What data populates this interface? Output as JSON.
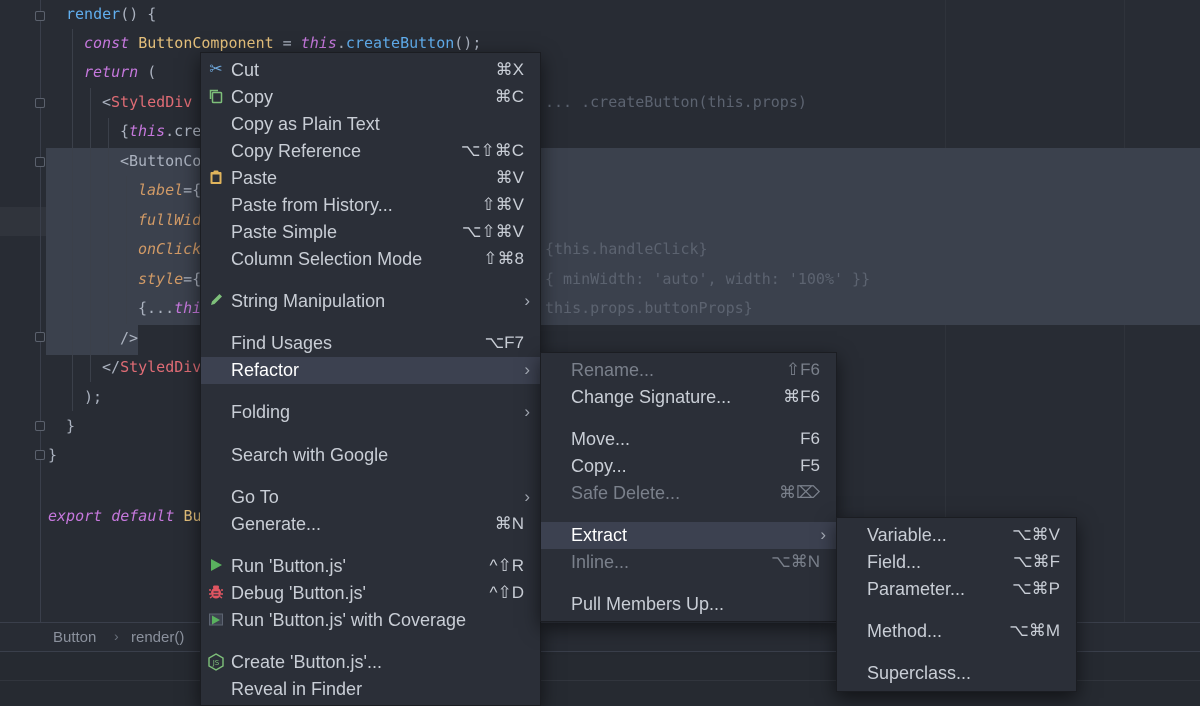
{
  "code": {
    "l1": {
      "name": "render",
      "rest": "() {"
    },
    "l2": {
      "kw": "const",
      "id": "ButtonComponent",
      "eq": " = ",
      "this": "this",
      "dot": ".",
      "fn": "createButton",
      "end": "();"
    },
    "l3": {
      "kw": "return",
      "rest": " ("
    },
    "l4": {
      "open": "<",
      "tag": "StyledDiv",
      "ghost": "... .createButton(this.props)"
    },
    "l5": {
      "brace": "{",
      "this": "this",
      "rest": ".crea"
    },
    "l6": {
      "open": "<ButtonCo"
    },
    "l7": {
      "attr": "label",
      "rest": "={"
    },
    "l8": {
      "attr": "fullWid"
    },
    "l9": {
      "attr": "onClick",
      "ghost": "{this.handleClick}"
    },
    "l10": {
      "attr": "style",
      "rest": "={",
      "ghost": "{ minWidth: 'auto', width: '100%' }}"
    },
    "l11": {
      "rest": "{...",
      "this": "thi",
      "ghost": "this.props.buttonProps}"
    },
    "l12": {
      "rest": "/>"
    },
    "l13": {
      "open": "</",
      "tag": "StyledDiv"
    },
    "l14": {
      "rest": ");"
    },
    "l15": {
      "rest": "}"
    },
    "l16": {
      "rest": "}"
    },
    "l18": {
      "kw1": "export",
      "kw2": "default",
      "id": "Bu"
    }
  },
  "breadcrumb": {
    "item1": "Button",
    "sep": "›",
    "item2": "render()"
  },
  "context_menu": {
    "cut": {
      "label": "Cut",
      "shortcut": "⌘X"
    },
    "copy": {
      "label": "Copy",
      "shortcut": "⌘C"
    },
    "copy_plain": {
      "label": "Copy as Plain Text"
    },
    "copy_ref": {
      "label": "Copy Reference",
      "shortcut": "⌥⇧⌘C"
    },
    "paste": {
      "label": "Paste",
      "shortcut": "⌘V"
    },
    "paste_history": {
      "label": "Paste from History...",
      "shortcut": "⇧⌘V"
    },
    "paste_simple": {
      "label": "Paste Simple",
      "shortcut": "⌥⇧⌘V"
    },
    "column_mode": {
      "label": "Column Selection Mode",
      "shortcut": "⇧⌘8"
    },
    "string_manip": {
      "label": "String Manipulation"
    },
    "find_usages": {
      "label": "Find Usages",
      "shortcut": "⌥F7"
    },
    "refactor": {
      "label": "Refactor"
    },
    "folding": {
      "label": "Folding"
    },
    "search_google": {
      "label": "Search with Google"
    },
    "go_to": {
      "label": "Go To"
    },
    "generate": {
      "label": "Generate...",
      "shortcut": "⌘N"
    },
    "run": {
      "label": "Run 'Button.js'",
      "shortcut": "^⇧R"
    },
    "debug": {
      "label": "Debug 'Button.js'",
      "shortcut": "^⇧D"
    },
    "run_coverage": {
      "label": "Run 'Button.js' with Coverage"
    },
    "create": {
      "label": "Create 'Button.js'..."
    },
    "reveal": {
      "label": "Reveal in Finder"
    },
    "arrow": "›"
  },
  "refactor_menu": {
    "rename": {
      "label": "Rename...",
      "shortcut": "⇧F6"
    },
    "change_sig": {
      "label": "Change Signature...",
      "shortcut": "⌘F6"
    },
    "move": {
      "label": "Move...",
      "shortcut": "F6"
    },
    "copy": {
      "label": "Copy...",
      "shortcut": "F5"
    },
    "safe_delete": {
      "label": "Safe Delete...",
      "shortcut": "⌘⌦"
    },
    "extract": {
      "label": "Extract"
    },
    "inline": {
      "label": "Inline...",
      "shortcut": "⌥⌘N"
    },
    "pull_up": {
      "label": "Pull Members Up..."
    }
  },
  "extract_menu": {
    "variable": {
      "label": "Variable...",
      "shortcut": "⌥⌘V"
    },
    "field": {
      "label": "Field...",
      "shortcut": "⌥⌘F"
    },
    "parameter": {
      "label": "Parameter...",
      "shortcut": "⌥⌘P"
    },
    "method": {
      "label": "Method...",
      "shortcut": "⌥⌘M"
    },
    "superclass": {
      "label": "Superclass..."
    }
  },
  "colors": {
    "active_item": "#3c4150",
    "selection": "#3b414d",
    "background": "#282c34"
  },
  "icons": {
    "cut": "scissors-icon",
    "copy": "copy-icon",
    "paste": "clipboard-icon",
    "string": "pencil-icon",
    "run": "play-icon",
    "debug": "bug-icon",
    "coverage": "coverage-icon",
    "create": "nodejs-icon"
  }
}
